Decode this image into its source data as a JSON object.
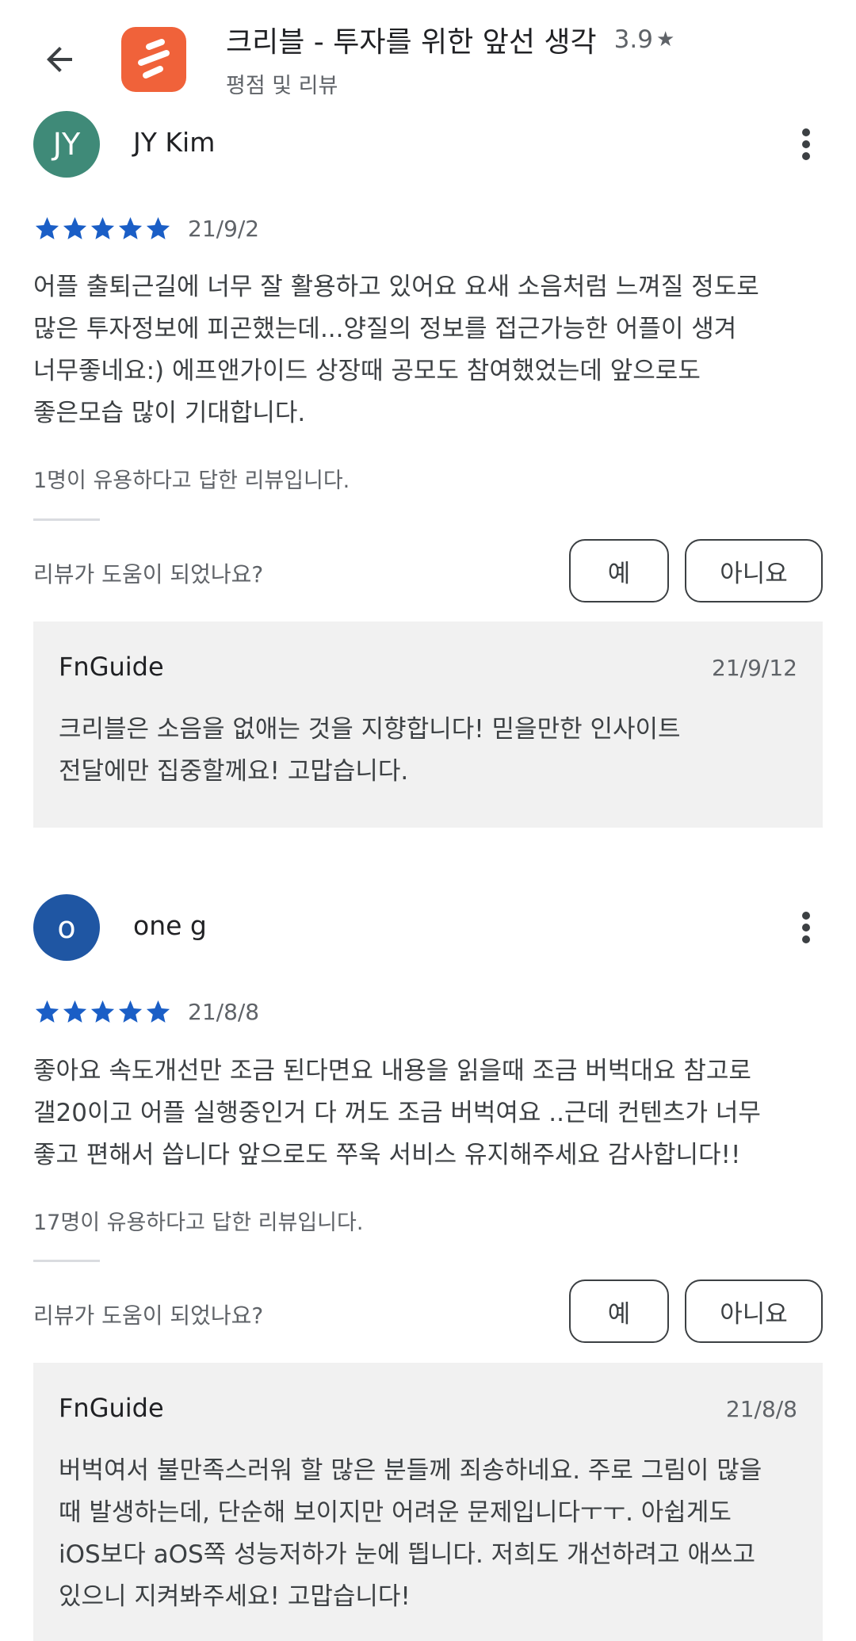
{
  "header": {
    "back_icon": "arrow-back-icon",
    "app_title": "크리블 - 투자를 위한 앞선 생각",
    "app_rating": "3.9",
    "subtitle": "평점 및 리뷰"
  },
  "colors": {
    "star": "#1a5ec6",
    "app_icon": "#f0623a",
    "avatar_1": "#3f8a78",
    "avatar_2": "#1f56a3",
    "reply_bg": "#f1f1f1"
  },
  "reviews": [
    {
      "avatar_text": "JY",
      "author": "JY Kim",
      "stars": 5,
      "date": "21/9/2",
      "text": "어플 출퇴근길에 너무 잘 활용하고 있어요 요새 소음처럼 느껴질 정도로\n많은 투자정보에 피곤했는데...양질의 정보를 접근가능한 어플이 생겨\n너무좋네요:) 에프앤가이드 상장때 공모도 참여했었는데 앞으로도\n좋은모습 많이 기대합니다.",
      "helpful": "1명이 유용하다고 답한 리뷰입니다.",
      "question": "리뷰가 도움이 되었나요?",
      "yes": "예",
      "no": "아니요",
      "reply": {
        "developer": "FnGuide",
        "date": "21/9/12",
        "text": "크리블은 소음을 없애는 것을 지향합니다! 믿을만한 인사이트\n전달에만 집중할께요! 고맙습니다."
      }
    },
    {
      "avatar_text": "o",
      "author": "one g",
      "stars": 5,
      "date": "21/8/8",
      "text": "좋아요 속도개선만 조금 된다면요 내용을 읽을때 조금 버벅대요 참고로\n갤20이고 어플 실행중인거 다 꺼도 조금 버벅여요 ..근데 컨텐츠가 너무\n좋고 편해서 씁니다 앞으로도 쭈욱 서비스 유지해주세요 감사합니다!!",
      "helpful": "17명이 유용하다고 답한 리뷰입니다.",
      "question": "리뷰가 도움이 되었나요?",
      "yes": "예",
      "no": "아니요",
      "reply": {
        "developer": "FnGuide",
        "date": "21/8/8",
        "text": "버벅여서 불만족스러워 할 많은 분들께 죄송하네요. 주로 그림이 많을\n때 발생하는데, 단순해 보이지만 어려운 문제입니다ㅜㅜ. 아쉽게도\niOS보다 aOS쪽 성능저하가 눈에 띕니다. 저희도 개선하려고 애쓰고\n있으니 지켜봐주세요! 고맙습니다!"
      }
    }
  ]
}
